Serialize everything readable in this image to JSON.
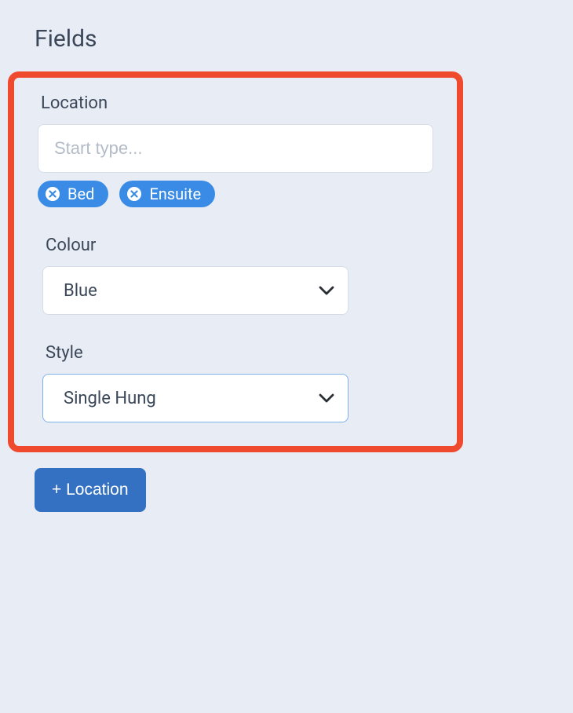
{
  "page": {
    "title": "Fields"
  },
  "location": {
    "label": "Location",
    "placeholder": "Start type...",
    "value": "",
    "tags": [
      {
        "label": "Bed"
      },
      {
        "label": "Ensuite"
      }
    ]
  },
  "colour": {
    "label": "Colour",
    "selected": "Blue"
  },
  "style": {
    "label": "Style",
    "selected": "Single Hung"
  },
  "actions": {
    "add_location_label": "+ Location"
  }
}
